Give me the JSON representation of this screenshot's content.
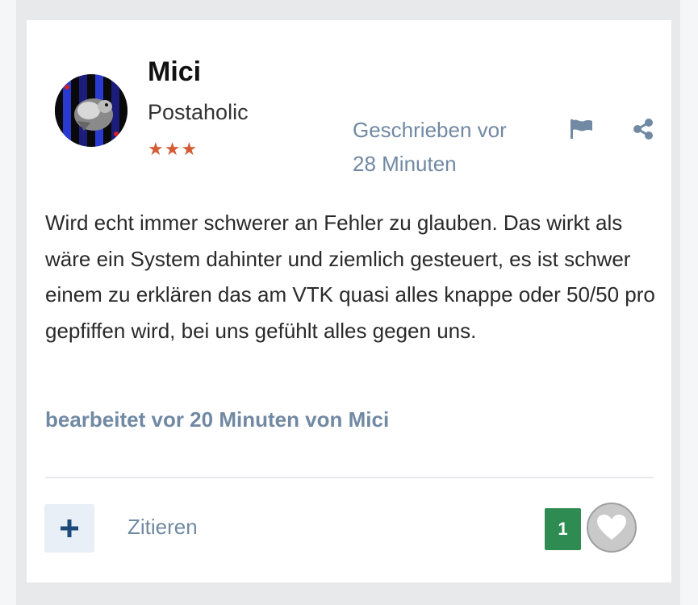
{
  "post": {
    "author": {
      "name": "Mici",
      "rank": "Postaholic",
      "stars": "★★★",
      "avatar_icon": "avatar-image"
    },
    "meta": {
      "written_label": "Geschrieben vor",
      "time_ago": "28 Minuten"
    },
    "text": "Wird echt immer schwerer an Fehler zu glauben. Das wirkt als wäre ein System dahinter und ziemlich gesteuert, es ist schwer einem zu erklären das am VTK quasi alles knappe oder 50/50 pro gepfiffen wird, bei uns gefühlt alles gegen uns.",
    "edited_note": "bearbeitet vor 20 Minuten von Mici"
  },
  "actions": {
    "plus_icon": "plus-icon",
    "quote_label": "Zitieren",
    "reaction_count": "1",
    "like_icon": "heart-icon",
    "flag_icon": "flag-icon",
    "share_icon": "share-icon"
  },
  "colors": {
    "accent": "#7189a3",
    "badge_green": "#2e8c52",
    "star_color": "#d35b35",
    "page_bg": "#e8e9eb"
  }
}
